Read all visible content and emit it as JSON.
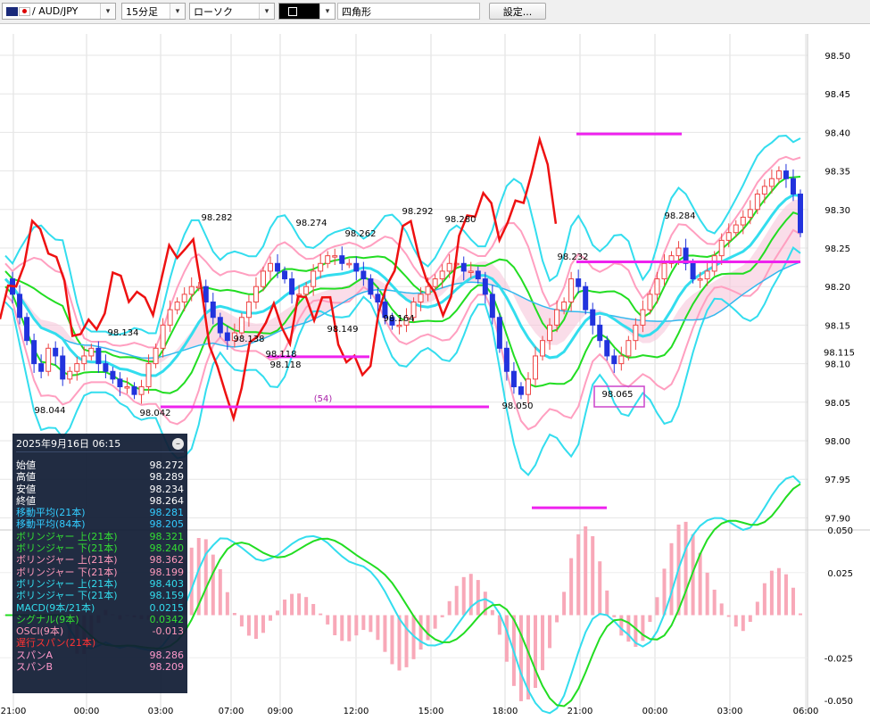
{
  "toolbar": {
    "symbol": "/ AUD/JPY",
    "timeframe": "15分足",
    "chart_type": "ローソク",
    "draw_tool": "四角形",
    "settings": "設定..."
  },
  "info_panel": {
    "date": "2025年9月16日  06:15",
    "rows": [
      {
        "label": "始値",
        "value": "98.272",
        "color": "#ffffff"
      },
      {
        "label": "高値",
        "value": "98.289",
        "color": "#ffffff"
      },
      {
        "label": "安値",
        "value": "98.234",
        "color": "#ffffff"
      },
      {
        "label": "終値",
        "value": "98.264",
        "color": "#ffffff"
      },
      {
        "label": "移動平均(21本)",
        "value": "98.281",
        "color": "#33ccff"
      },
      {
        "label": "移動平均(84本)",
        "value": "98.205",
        "color": "#33ccff"
      },
      {
        "label": "ボリンジャー 上(21本)",
        "value": "98.321",
        "color": "#33dd33"
      },
      {
        "label": "ボリンジャー 下(21本)",
        "value": "98.240",
        "color": "#33dd33"
      },
      {
        "label": "ボリンジャー 上(21本)",
        "value": "98.362",
        "color": "#ff99bb"
      },
      {
        "label": "ボリンジャー 下(21本)",
        "value": "98.199",
        "color": "#ff99bb"
      },
      {
        "label": "ボリンジャー 上(21本)",
        "value": "98.403",
        "color": "#33ddee"
      },
      {
        "label": "ボリンジャー 下(21本)",
        "value": "98.159",
        "color": "#33ddee"
      },
      {
        "label": "MACD(9本/21本)",
        "value": "0.0215",
        "color": "#33ddee"
      },
      {
        "label": "シグナル(9本)",
        "value": "0.0342",
        "color": "#33dd33"
      },
      {
        "label": "OSCI(9本)",
        "value": "-0.013",
        "color": "#ff99bb"
      },
      {
        "label": "遅行スパン(21本)",
        "value": "",
        "color": "#ff3333"
      },
      {
        "label": "スパンA",
        "value": "98.286",
        "color": "#ff99cc"
      },
      {
        "label": "スパンB",
        "value": "98.209",
        "color": "#ff99cc"
      }
    ]
  },
  "chart_data": [
    {
      "type": "candlestick",
      "title": "",
      "ylim": [
        97.88,
        98.545
      ],
      "y_ticks": [
        "98.50",
        "98.45",
        "98.40",
        "98.35",
        "98.30",
        "98.25",
        "98.20",
        "98.15",
        "98.10",
        "98.05",
        "98.00",
        "97.95",
        "97.90"
      ],
      "x_ticks": [
        "21:00",
        "00:00",
        "03:00",
        "07:00",
        "09:00",
        "12:00",
        "15:00",
        "18:00",
        "21:00",
        "00:00",
        "03:00",
        "06:00"
      ],
      "highlight_y_label": "98.115",
      "price_annotations": [
        "98.044",
        "98.134",
        "98.042",
        "98.282",
        "98.138",
        "98.118",
        "98.118",
        "98.274",
        "98.149",
        "98.262",
        "98.164",
        "98.292",
        "98.280",
        "98.050",
        "98.232",
        "98.065",
        "98.284"
      ],
      "count_label": "(54)",
      "close_series": [
        98.21,
        98.19,
        98.16,
        98.13,
        98.1,
        98.09,
        98.12,
        98.11,
        98.08,
        98.09,
        98.1,
        98.11,
        98.12,
        98.1,
        98.09,
        98.08,
        98.07,
        98.07,
        98.06,
        98.07,
        98.1,
        98.12,
        98.15,
        98.17,
        98.18,
        98.19,
        98.2,
        98.2,
        98.18,
        98.16,
        98.14,
        98.13,
        98.14,
        98.16,
        98.18,
        98.2,
        98.22,
        98.23,
        98.22,
        98.21,
        98.19,
        98.19,
        98.2,
        98.22,
        98.23,
        98.24,
        98.24,
        98.23,
        98.23,
        98.22,
        98.21,
        98.19,
        98.18,
        98.16,
        98.15,
        98.15,
        98.16,
        98.18,
        98.19,
        98.2,
        98.21,
        98.22,
        98.23,
        98.23,
        98.22,
        98.22,
        98.21,
        98.19,
        98.16,
        98.12,
        98.09,
        98.07,
        98.06,
        98.08,
        98.11,
        98.13,
        98.15,
        98.17,
        98.18,
        98.21,
        98.2,
        98.17,
        98.15,
        98.13,
        98.11,
        98.1,
        98.11,
        98.13,
        98.15,
        98.17,
        98.19,
        98.21,
        98.23,
        98.24,
        98.25,
        98.23,
        98.21,
        98.21,
        98.22,
        98.24,
        98.26,
        98.27,
        98.28,
        98.29,
        98.3,
        98.32,
        98.33,
        98.34,
        98.35,
        98.34,
        98.32,
        98.27
      ]
    },
    {
      "type": "macd",
      "ylim": [
        -0.05,
        0.05
      ],
      "y_ticks": [
        "0.050",
        "0.025",
        "-0.025",
        "-0.050"
      ]
    }
  ]
}
